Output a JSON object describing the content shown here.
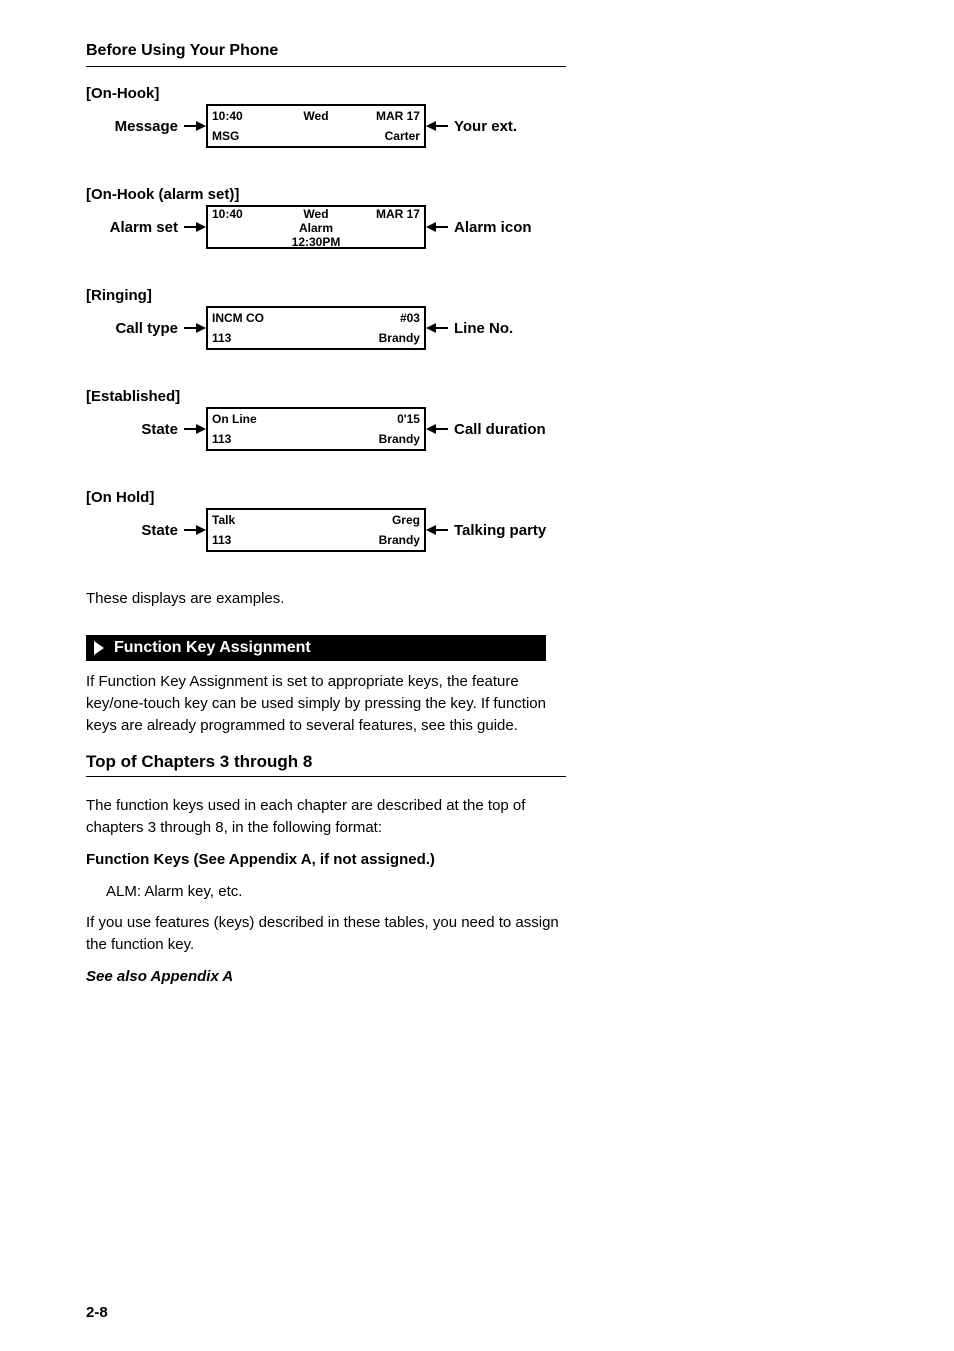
{
  "header": {
    "chapter": "Before Using Your Phone",
    "page": "2-8"
  },
  "displays": [
    {
      "caption": "[On-Hook]",
      "lines": [
        [
          "10:40",
          "Wed",
          "MAR 17"
        ],
        [
          "MSG",
          "",
          "Carter"
        ]
      ],
      "leftIcon": 1,
      "rightIcon": 0,
      "annL": "Message",
      "annR": "Your ext."
    },
    {
      "caption": "[On-Hook (alarm set)]",
      "lines": [
        [
          "10:40",
          "Wed",
          "MAR 17"
        ],
        [
          "",
          "Alarm   12:30PM",
          ""
        ]
      ],
      "leftIcon": 1,
      "rightIcon": -1,
      "annL": "Alarm set",
      "annR": "Alarm icon"
    },
    {
      "caption": "[Ringing]",
      "lines": [
        [
          "INCM CO",
          "",
          "#03"
        ],
        [
          "113",
          "",
          "Brandy"
        ]
      ],
      "leftIcon": -1,
      "rightIcon": -1,
      "annL": "Call type",
      "annR": "Line No."
    },
    {
      "caption": "[Established]",
      "lines": [
        [
          "On Line",
          "",
          "0'15"
        ],
        [
          "113",
          "",
          "Brandy"
        ]
      ],
      "leftIcon": -1,
      "rightIcon": -1,
      "annL": "State",
      "annR": "Call duration"
    },
    {
      "caption": "[On Hold]",
      "lines": [
        [
          "Talk",
          "",
          "Greg"
        ],
        [
          "113",
          "",
          "Brandy"
        ]
      ],
      "leftIcon": -1,
      "rightIcon": -1,
      "annL": "State",
      "annR": "Talking party"
    }
  ],
  "examples_note": "These displays are examples.",
  "feature": {
    "title": "Function Key Assignment",
    "intro": "If Function Key Assignment is set to appropriate keys, the feature key/one-touch key can be used simply by pressing the key. If function keys are already programmed to several features, see this guide.",
    "top_title": "Top of Chapters 3 through 8",
    "top_text": "The function keys used in each chapter are described at the top of chapters 3 through 8, in the following format:",
    "fa": "Function Keys (See Appendix A, if not assigned.)",
    "fa_item": "ALM: Alarm key, etc.",
    "mid": "If you use features (keys) described in these tables, you need to assign the function key.",
    "appendix": "See also Appendix A"
  }
}
